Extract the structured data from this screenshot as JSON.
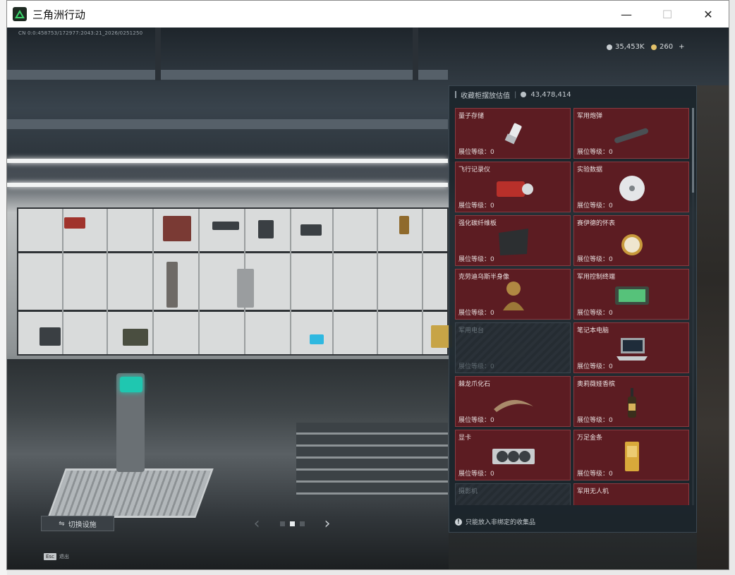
{
  "window": {
    "title": "三角洲行动",
    "minimize": "—",
    "maximize": "☐",
    "close": "✕"
  },
  "hud": {
    "cn_id": "CN 0:0:458753/172977:2043:21_2026/0251250",
    "currency_a": "35,453K",
    "currency_b": "260",
    "currency_b_plus": "+"
  },
  "panel": {
    "title": "收藏柜摆放估值",
    "value": "43,478,414",
    "footer": "只能放入非绑定的收集品",
    "level_label": "展位等级："
  },
  "items": [
    {
      "name": "量子存储",
      "level": "0",
      "locked": false,
      "icon": "usb-drive-icon"
    },
    {
      "name": "军用炮弹",
      "level": "0",
      "locked": false,
      "icon": "shell-icon"
    },
    {
      "name": "飞行记录仪",
      "level": "0",
      "locked": false,
      "icon": "flight-recorder-icon"
    },
    {
      "name": "实验数据",
      "level": "0",
      "locked": false,
      "icon": "disc-icon"
    },
    {
      "name": "强化碳纤维板",
      "level": "0",
      "locked": false,
      "icon": "carbon-plate-icon"
    },
    {
      "name": "赛伊德的怀表",
      "level": "0",
      "locked": false,
      "icon": "pocket-watch-icon"
    },
    {
      "name": "克劳迪乌斯半身像",
      "level": "0",
      "locked": false,
      "icon": "bust-icon"
    },
    {
      "name": "军用控制终端",
      "level": "0",
      "locked": false,
      "icon": "control-terminal-icon"
    },
    {
      "name": "军用电台",
      "level": "0",
      "locked": true,
      "icon": "radio-icon"
    },
    {
      "name": "笔记本电脑",
      "level": "0",
      "locked": false,
      "icon": "laptop-icon"
    },
    {
      "name": "棘龙爪化石",
      "level": "0",
      "locked": false,
      "icon": "claw-fossil-icon"
    },
    {
      "name": "奥莉薇娅香槟",
      "level": "0",
      "locked": false,
      "icon": "champagne-icon"
    },
    {
      "name": "显卡",
      "level": "0",
      "locked": false,
      "icon": "gpu-icon"
    },
    {
      "name": "万足金条",
      "level": "0",
      "locked": false,
      "icon": "gold-bar-icon"
    },
    {
      "name": "摄影机",
      "level": "",
      "locked": true,
      "icon": "camera-icon"
    },
    {
      "name": "军用无人机",
      "level": "",
      "locked": false,
      "icon": "drone-icon"
    }
  ],
  "controls": {
    "switch_label": "切换设施",
    "prev": "‹",
    "next": "›",
    "esc_key": "Esc",
    "esc_label": "退出"
  },
  "colors": {
    "card_bg": "#5c1c22",
    "card_border": "#8a3a40",
    "panel_bg": "#1c252c",
    "accent_teal": "#1fc7b0"
  }
}
